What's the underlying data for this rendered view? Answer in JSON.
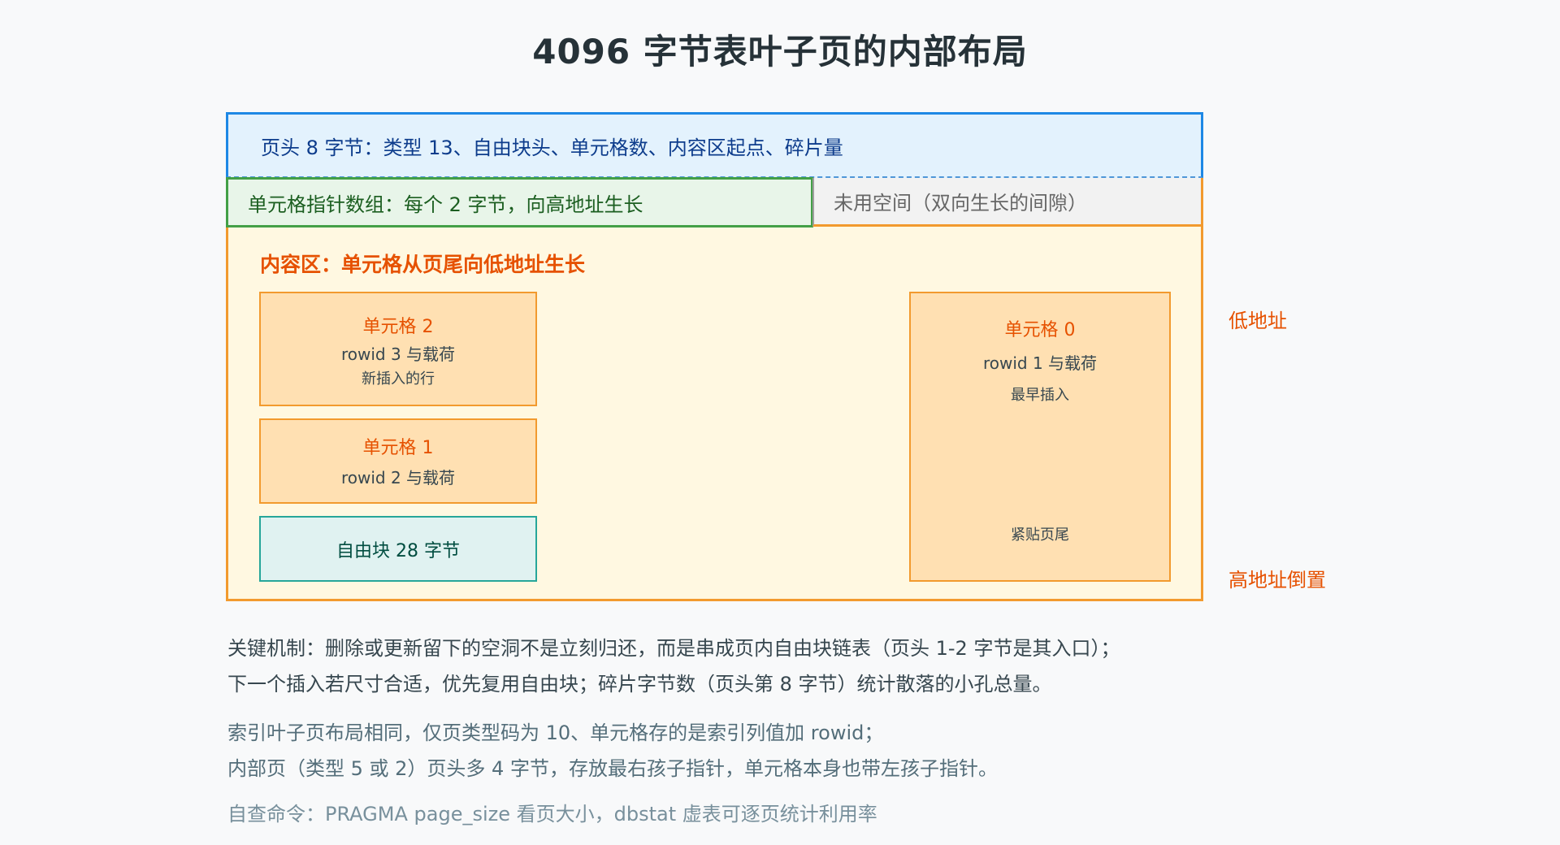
{
  "title": "4096 字节表叶子页的内部布局",
  "page": {
    "header": "页头 8 字节：类型 13、自由块头、单元格数、内容区起点、碎片量",
    "pointer_array": "单元格指针数组：每个 2 字节，向高地址生长",
    "unused_space": "未用空间（双向生长的间隙）",
    "content_area_label": "内容区：单元格从页尾向低地址生长",
    "cells": [
      {
        "name": "单元格 2",
        "row": "rowid 3 与载荷",
        "note": "新插入的行"
      },
      {
        "name": "单元格 1",
        "row": "rowid 2 与载荷"
      },
      {
        "name": "单元格 0",
        "row": "rowid 1 与载荷",
        "note": "最早插入",
        "tail": "紧贴页尾"
      }
    ],
    "freeblock": "自由块 28 字节"
  },
  "side_labels": {
    "low": "低地址",
    "high": "高地址倒置"
  },
  "notes": {
    "key_mechanism": [
      "关键机制：删除或更新留下的空洞不是立刻归还，而是串成页内自由块链表（页头 1-2 字节是其入口）；",
      "下一个插入若尺寸合适，优先复用自由块；碎片字节数（页头第 8 字节）统计散落的小孔总量。"
    ],
    "index_pages": [
      "索引叶子页布局相同，仅页类型码为 10、单元格存的是索引列值加 rowid；",
      "内部页（类型 5 或 2）页头多 4 字节，存放最右孩子指针，单元格本身也带左孩子指针。"
    ],
    "self_check": "自查命令：PRAGMA page_size 看页大小，dbstat 虚表可逐页统计利用率"
  },
  "colors": {
    "header_border": "#1e88e5",
    "pointer_border": "#43a047",
    "content_border": "#f29a2e",
    "freeblock_border": "#26a69a",
    "accent": "#e65100"
  }
}
